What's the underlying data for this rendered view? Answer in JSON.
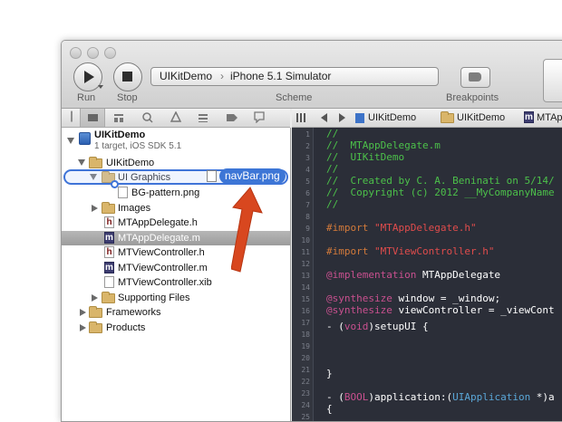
{
  "toolbar": {
    "run_label": "Run",
    "stop_label": "Stop",
    "scheme_project": "UIKitDemo",
    "scheme_separator": "›",
    "scheme_destination": "iPhone 5.1 Simulator",
    "scheme_label": "Scheme",
    "breakpoints_label": "Breakpoints"
  },
  "navigator": {
    "project_title": "UIKitDemo",
    "project_subtitle": "1 target, iOS SDK 5.1",
    "items": [
      {
        "label": "UIKitDemo",
        "kind": "folder",
        "expanded": true,
        "level": 1
      },
      {
        "label": "UI Graphics",
        "kind": "folder",
        "expanded": true,
        "level": 2
      },
      {
        "label": "BG-pattern.png",
        "kind": "image",
        "level": 3
      },
      {
        "label": "Images",
        "kind": "folder",
        "expanded": false,
        "level": 2
      },
      {
        "label": "MTAppDelegate.h",
        "kind": "h",
        "icon_letter": "h",
        "level": 2
      },
      {
        "label": "MTAppDelegate.m",
        "kind": "m",
        "icon_letter": "m",
        "level": 2,
        "selected": true
      },
      {
        "label": "MTViewController.h",
        "kind": "h",
        "icon_letter": "h",
        "level": 2
      },
      {
        "label": "MTViewController.m",
        "kind": "m",
        "icon_letter": "m",
        "level": 2
      },
      {
        "label": "MTViewController.xib",
        "kind": "xib",
        "level": 2
      },
      {
        "label": "Supporting Files",
        "kind": "folder",
        "expanded": false,
        "level": 2
      },
      {
        "label": "Frameworks",
        "kind": "folder",
        "expanded": false,
        "level": 1
      },
      {
        "label": "Products",
        "kind": "folder",
        "expanded": false,
        "level": 1
      }
    ],
    "drag_file": "navBar.png"
  },
  "jumpbar": {
    "crumb1": "UIKitDemo",
    "crumb2": "UIKitDemo",
    "crumb3": "MTAp",
    "crumb3_letter": "m"
  },
  "editor": {
    "line_numbers": [
      "1",
      "2",
      "3",
      "4",
      "5",
      "6",
      "7",
      "8",
      "9",
      "10",
      "11",
      "12",
      "13",
      "14",
      "15",
      "16",
      "17",
      "18",
      "19",
      "20",
      "21",
      "22",
      "23",
      "24",
      "25"
    ],
    "code": {
      "l1": "//",
      "l2": "//  MTAppDelegate.m",
      "l3": "//  UIKitDemo",
      "l4": "//",
      "l5": "//  Created by C. A. Beninati on 5/14/",
      "l6": "//  Copyright (c) 2012 __MyCompanyName",
      "l7": "//",
      "l8_dir": "#import ",
      "l8_str": "\"MTAppDelegate.h\"",
      "l9_dir": "#import ",
      "l9_str": "\"MTViewController.h\"",
      "l10_kw": "@implementation",
      "l10_rest": " MTAppDelegate",
      "l11_kw": "@synthesize",
      "l11_rest": " window = _window;",
      "l12_kw": "@synthesize",
      "l12_rest": " viewController = _viewCont",
      "l13_a": "- (",
      "l13_kw": "void",
      "l13_b": ")setupUI {",
      "l14": "}",
      "l15_a": "- (",
      "l15_kw": "BOOL",
      "l15_b": ")application:(",
      "l15_type": "UIApplication",
      "l15_c": " *)a",
      "l16": "{"
    }
  },
  "colors": {
    "selection_blue": "#3f74d8",
    "editor_background": "#2b2e38",
    "comment_green": "#4cc04a",
    "arrow_red": "#d8471f"
  }
}
